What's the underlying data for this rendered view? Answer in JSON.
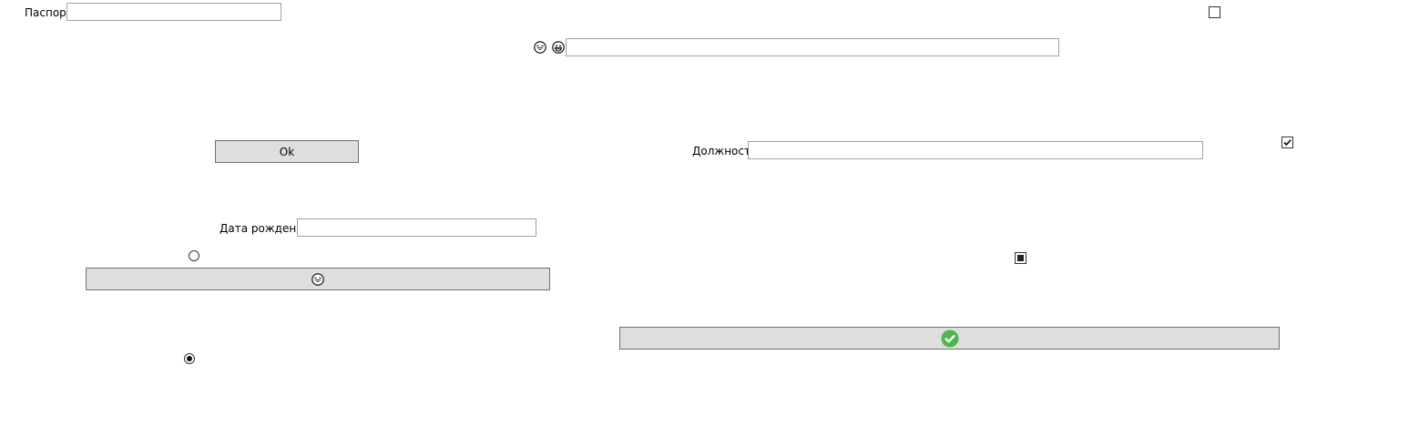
{
  "fields": {
    "passport": {
      "label": "Паспорт",
      "value": ""
    },
    "top_text": {
      "value": ""
    },
    "position": {
      "label": "Должность",
      "value": ""
    },
    "birth_date": {
      "label": "Дата рождения",
      "value": ""
    }
  },
  "buttons": {
    "ok": {
      "label": "Ok"
    },
    "emoji_button": {
      "icon": "laughing-face-icon"
    },
    "confirm_button": {
      "icon": "green-check-circle-icon",
      "color": "#4cb84c"
    }
  },
  "checkboxes": {
    "top_right": {
      "state": "unchecked"
    },
    "position_check": {
      "state": "checked"
    },
    "middle_right": {
      "state": "indeterminate"
    }
  },
  "radios": {
    "first": {
      "state": "unselected"
    },
    "second": {
      "state": "selected"
    }
  },
  "icons": {
    "face_one": "laughing-face-icon",
    "face_two": "grinning-face-icon"
  }
}
